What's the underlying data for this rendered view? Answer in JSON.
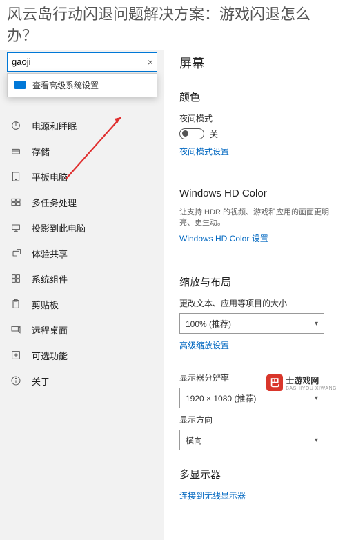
{
  "article": {
    "title": "风云岛行动闪退问题解决方案：游戏闪退怎么办？"
  },
  "sidebar": {
    "search": {
      "value": "gaoji",
      "clear_icon": "×"
    },
    "search_result": {
      "label": "查看高级系统设置"
    },
    "items": [
      {
        "label": "电源和睡眠",
        "icon": "power"
      },
      {
        "label": "存储",
        "icon": "storage"
      },
      {
        "label": "平板电脑",
        "icon": "tablet"
      },
      {
        "label": "多任务处理",
        "icon": "multitask"
      },
      {
        "label": "投影到此电脑",
        "icon": "project"
      },
      {
        "label": "体验共享",
        "icon": "share"
      },
      {
        "label": "系统组件",
        "icon": "component"
      },
      {
        "label": "剪贴板",
        "icon": "clipboard"
      },
      {
        "label": "远程桌面",
        "icon": "remote"
      },
      {
        "label": "可选功能",
        "icon": "optional"
      },
      {
        "label": "关于",
        "icon": "about"
      }
    ]
  },
  "content": {
    "title": "屏幕",
    "color": {
      "heading": "颜色",
      "night_mode_label": "夜间模式",
      "night_mode_state": "关",
      "night_mode_link": "夜间模式设置"
    },
    "hdr": {
      "heading": "Windows HD Color",
      "desc": "让支持 HDR 的视频、游戏和应用的画面更明亮、更生动。",
      "link": "Windows HD Color 设置"
    },
    "scale": {
      "heading": "缩放与布局",
      "text_size_label": "更改文本、应用等项目的大小",
      "text_size_value": "100% (推荐)",
      "advanced_link": "高级缩放设置",
      "resolution_label": "显示器分辨率",
      "resolution_value": "1920 × 1080 (推荐)",
      "orientation_label": "显示方向",
      "orientation_value": "横向"
    },
    "multi": {
      "heading": "多显示器",
      "link": "连接到无线显示器"
    }
  },
  "watermark": {
    "icon_text": "巴",
    "text": "士游戏网",
    "sub": "BASHIYOU XIWANG"
  }
}
